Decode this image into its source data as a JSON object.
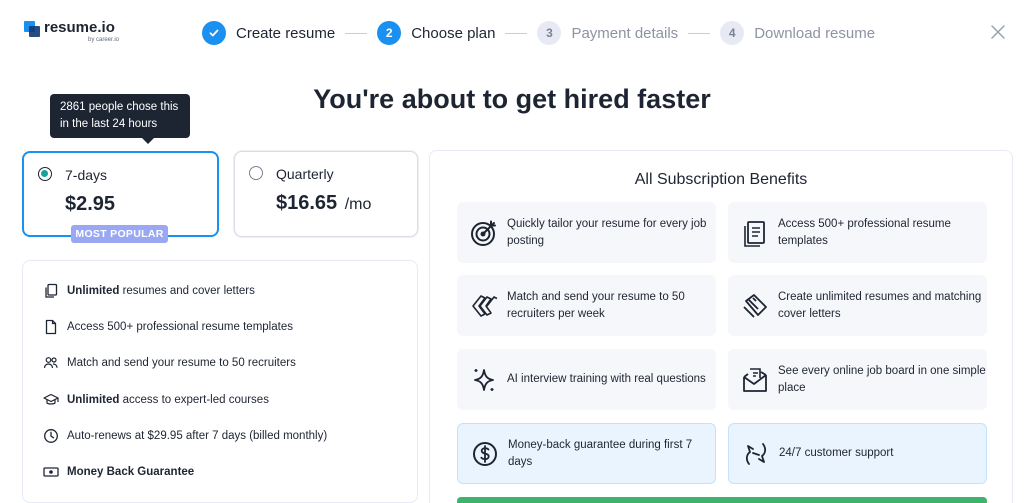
{
  "brand": {
    "name": "resume.io",
    "sub": "by career.io"
  },
  "stepper": {
    "steps": [
      {
        "num": "✓",
        "label": "Create resume"
      },
      {
        "num": "2",
        "label": "Choose plan"
      },
      {
        "num": "3",
        "label": "Payment details"
      },
      {
        "num": "4",
        "label": "Download resume"
      }
    ]
  },
  "headline": "You're about to get hired faster",
  "tooltip": "2861 people chose this in the last 24 hours",
  "plans": [
    {
      "name": "7-days",
      "price": "$2.95",
      "per": "",
      "selected": true,
      "badge": "MOST POPULAR"
    },
    {
      "name": "Quarterly",
      "price": "$16.65",
      "per": "/mo",
      "selected": false
    }
  ],
  "features": [
    {
      "icon": "copy-icon",
      "bold": "Unlimited",
      "text": " resumes and cover letters"
    },
    {
      "icon": "document-icon",
      "bold": "",
      "text": "Access 500+ professional resume templates"
    },
    {
      "icon": "users-icon",
      "bold": "",
      "text": "Match and send your resume to 50 recruiters"
    },
    {
      "icon": "graduation-cap-icon",
      "bold": "Unlimited",
      "text": " access to expert-led courses"
    },
    {
      "icon": "clock-icon",
      "bold": "",
      "text": "Auto-renews at $29.95 after 7 days (billed monthly)"
    },
    {
      "icon": "money-icon",
      "bold": "Money Back Guarantee",
      "text": ""
    }
  ],
  "benefits": {
    "title": "All Subscription Benefits",
    "cards": [
      {
        "icon": "target-icon",
        "text": "Quickly tailor your resume for every job posting",
        "highlight": false
      },
      {
        "icon": "templates-icon",
        "text": "Access 500+ professional resume templates",
        "highlight": false
      },
      {
        "icon": "send-icon",
        "text": "Match and send your resume to 50 recruiters per week",
        "highlight": false
      },
      {
        "icon": "cover-letter-icon",
        "text": "Create unlimited resumes and matching cover letters",
        "highlight": false
      },
      {
        "icon": "sparkle-icon",
        "text": "AI interview training with real questions",
        "highlight": false
      },
      {
        "icon": "job-board-icon",
        "text": "See every online job board in one simple place",
        "highlight": false
      },
      {
        "icon": "dollar-icon",
        "text": "Money-back guarantee during first 7 days",
        "highlight": true
      },
      {
        "icon": "support-icon",
        "text": "24/7 customer support",
        "highlight": true
      }
    ]
  },
  "colors": {
    "accent": "#1a91f0",
    "radio": "#16a39a",
    "badge": "#9aa8f4",
    "cta": "#3db36b"
  }
}
